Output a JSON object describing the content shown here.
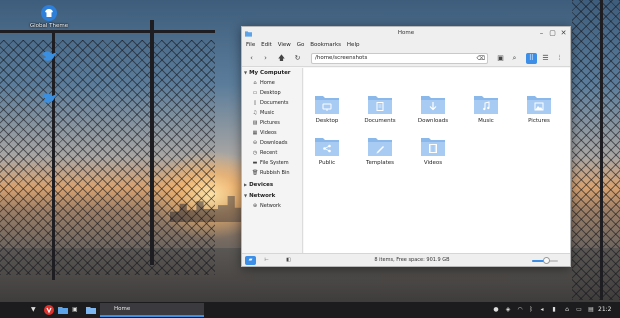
{
  "desktop": {
    "icons": [
      {
        "label": "Global Theme",
        "icon": "tshirt-icon"
      },
      {
        "label": "",
        "icon": "bird-icon"
      },
      {
        "label": "",
        "icon": "bird-icon"
      }
    ]
  },
  "window": {
    "title": "Home",
    "accent": "#3d8ee6",
    "menu": [
      "File",
      "Edit",
      "View",
      "Go",
      "Bookmarks",
      "Help"
    ],
    "address": "/home/screenshots",
    "sidebar": {
      "my_computer": "My Computer",
      "items": [
        {
          "label": "Home",
          "icon": "home-icon"
        },
        {
          "label": "Desktop",
          "icon": "desktop-icon"
        },
        {
          "label": "Documents",
          "icon": "document-icon"
        },
        {
          "label": "Music",
          "icon": "music-icon"
        },
        {
          "label": "Pictures",
          "icon": "picture-icon"
        },
        {
          "label": "Videos",
          "icon": "video-icon"
        },
        {
          "label": "Downloads",
          "icon": "download-icon"
        },
        {
          "label": "Recent",
          "icon": "clock-icon"
        },
        {
          "label": "File System",
          "icon": "drive-icon"
        },
        {
          "label": "Rubbish Bin",
          "icon": "trash-icon"
        }
      ],
      "devices": "Devices",
      "network_head": "Network",
      "network_item": "Network"
    },
    "folders": [
      {
        "name": "Desktop",
        "emblem": "desktop-icon"
      },
      {
        "name": "Documents",
        "emblem": "document-icon"
      },
      {
        "name": "Downloads",
        "emblem": "download-icon"
      },
      {
        "name": "Music",
        "emblem": "music-icon"
      },
      {
        "name": "Pictures",
        "emblem": "picture-icon"
      },
      {
        "name": "Public",
        "emblem": "share-icon"
      },
      {
        "name": "Templates",
        "emblem": "template-icon"
      },
      {
        "name": "Videos",
        "emblem": "video-icon"
      }
    ],
    "status": "8 items, Free space: 901.9 GB",
    "zoom_level": 0.55
  },
  "taskbar": {
    "task_label": "Home",
    "clock": "21:2"
  }
}
